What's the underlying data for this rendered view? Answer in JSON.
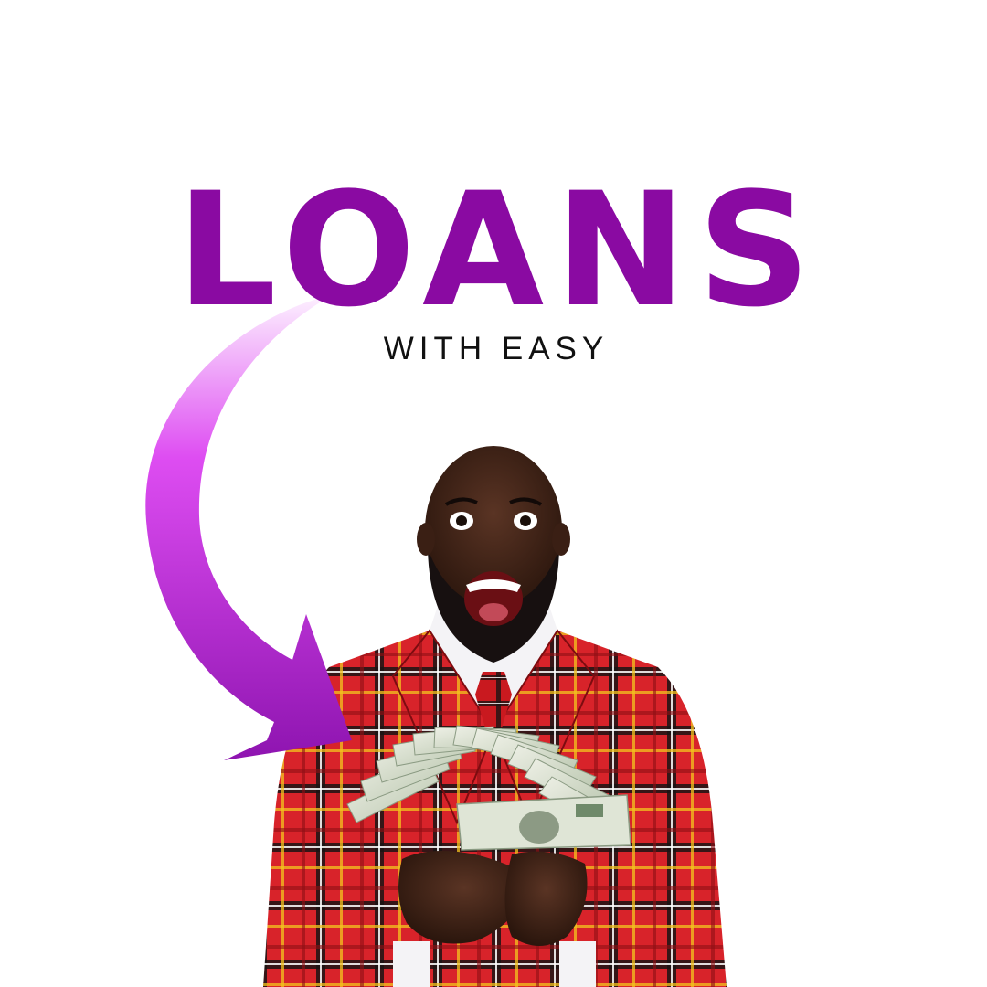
{
  "headline": {
    "text": "LOANS"
  },
  "subheadline": {
    "text": "WITH EASY"
  },
  "colors": {
    "brand_purple": "#8a0aa2",
    "arrow_light": "#f7e3fb",
    "arrow_mid": "#d23ee6",
    "arrow_dark": "#8e14b0",
    "text_dark": "#111111",
    "suit_red": "#d8232a",
    "tie_red": "#c9191f",
    "skin": "#3a1f14",
    "beard": "#171010",
    "money_green": "#c9d6c0"
  },
  "icons": {
    "arrow": "curved-arrow-icon"
  }
}
